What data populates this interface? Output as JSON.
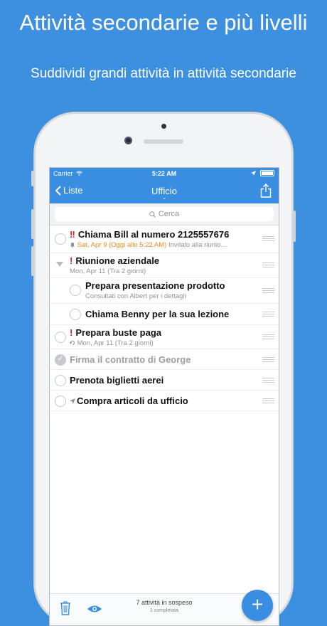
{
  "headline": "Attività secondarie e più livelli",
  "subheadline": "Suddividi grandi attività in attività secondarie",
  "status_bar": {
    "carrier": "Carrier",
    "time": "5:22 AM"
  },
  "nav": {
    "back_label": "Liste",
    "title": "Ufficio"
  },
  "search": {
    "placeholder": "Cerca"
  },
  "tasks": [
    {
      "priority": "‼",
      "title": "Chiama Bill al numero 2125557676",
      "alarm_text": "Sat, Apr 9 (Oggi alle 5:22 AM)",
      "note": "Invitalo alla riunio…"
    },
    {
      "priority": "!",
      "title": "Riunione aziendale",
      "subtitle": "Mon, Apr 11 (Tra 2 giorni)"
    },
    {
      "title": "Prepara presentazione prodotto",
      "subtitle": "Consultati con Albert per i dettagli"
    },
    {
      "title": "Chiama Benny per la sua lezione"
    },
    {
      "priority": "!",
      "title": "Prepara buste paga",
      "subtitle": "Mon, Apr 11 (Tra 2 giorni)"
    },
    {
      "title": "Firma il contratto di George"
    },
    {
      "title": "Prenota biglietti aerei"
    },
    {
      "title": "Compra articoli da ufficio"
    }
  ],
  "toolbar": {
    "pending": "7 attività in sospeso",
    "completed": "1 completata",
    "add_label": "+"
  },
  "colors": {
    "background": "#3d8fe0",
    "nav_bar": "#3a8ee2",
    "priority": "#e52222",
    "alarm": "#f08a1d"
  }
}
